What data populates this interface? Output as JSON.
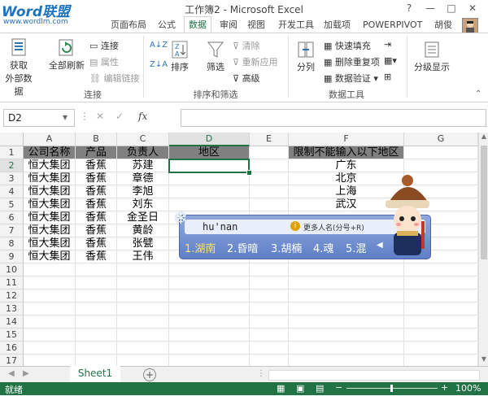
{
  "window": {
    "title": "工作簿2 - Microsoft Excel",
    "logo_text": "Word联盟",
    "logo_url": "www.wordlm.com",
    "controls": [
      "?",
      "—",
      "□",
      "✕"
    ]
  },
  "tabs": [
    "页面布局",
    "公式",
    "数据",
    "审阅",
    "视图",
    "开发工具",
    "加载项",
    "POWERPIVOT"
  ],
  "active_tab": "数据",
  "user_name": "胡俊",
  "ribbon": {
    "get_external": {
      "line1": "获取",
      "line2": "外部数据"
    },
    "refresh_all": {
      "line1": "全部刷新"
    },
    "connections": [
      "连接",
      "属性",
      "编辑链接"
    ],
    "group_connections": "连接",
    "sort_az": "A↓Z",
    "sort_za": "Z↓A",
    "sort": "排序",
    "filter": "筛选",
    "filter_small": [
      "清除",
      "重新应用",
      "高级"
    ],
    "group_sortfilter": "排序和筛选",
    "text_to_columns": "分列",
    "data_tools_small": [
      "快速填充",
      "删除重复项",
      "数据验证"
    ],
    "group_datatools": "数据工具",
    "outline": "分级显示"
  },
  "formula_bar": {
    "name_box": "D2",
    "fx": "fx",
    "value": ""
  },
  "columns": [
    "A",
    "B",
    "C",
    "D",
    "E",
    "F",
    "G"
  ],
  "selected_column": "D",
  "rows": [
    "1",
    "2",
    "3",
    "4",
    "5",
    "6",
    "7",
    "8",
    "9",
    "10",
    "11",
    "12",
    "13",
    "14",
    "15",
    "16",
    "17"
  ],
  "selected_row": "2",
  "table": {
    "headers": [
      "公司名称",
      "产品",
      "负责人",
      "地区"
    ],
    "data": [
      [
        "恒大集团",
        "香蕉",
        "苏建"
      ],
      [
        "恒大集团",
        "香蕉",
        "章德"
      ],
      [
        "恒大集团",
        "香蕉",
        "李旭"
      ],
      [
        "恒大集团",
        "香蕉",
        "刘东"
      ],
      [
        "恒大集团",
        "香蕉",
        "金圣日"
      ],
      [
        "恒大集团",
        "香蕉",
        "黄龄"
      ],
      [
        "恒大集团",
        "香蕉",
        "张甓"
      ],
      [
        "恒大集团",
        "香蕉",
        "王伟"
      ]
    ]
  },
  "restriction": {
    "header": "限制不能输入以下地区",
    "items": [
      "广东",
      "北京",
      "上海",
      "武汉"
    ]
  },
  "ime": {
    "input": "hu'nan",
    "hint": "更多人名(分号+R)",
    "candidates": [
      "1.湖南",
      "2.昏暗",
      "3.胡楠",
      "4.魂",
      "5.混"
    ]
  },
  "sheet_tab": "Sheet1",
  "add_sheet": "+",
  "status": {
    "ready": "就绪",
    "zoom": "100%"
  },
  "colors": {
    "excel_green": "#217346",
    "header_gray": "#808080"
  }
}
